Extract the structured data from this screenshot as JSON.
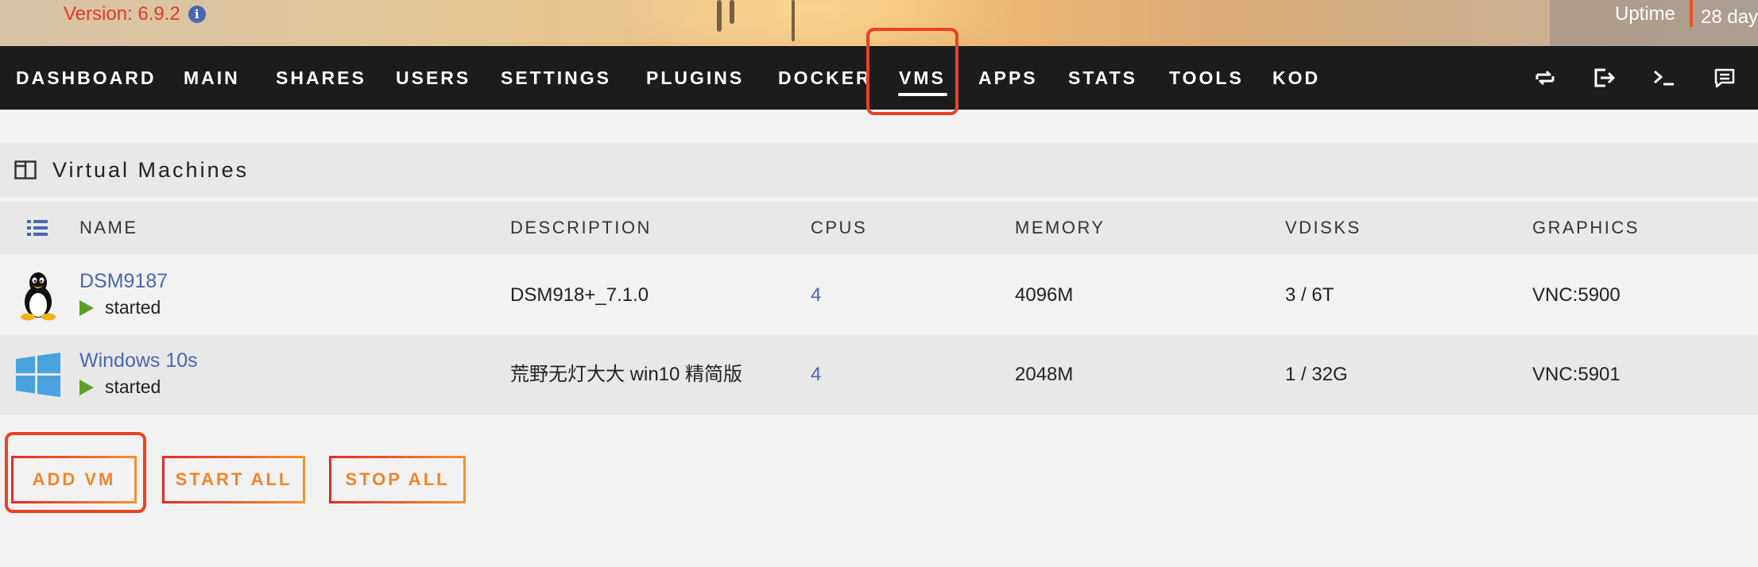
{
  "header": {
    "version": "Version: 6.9.2",
    "uptime_label": "Uptime",
    "uptime_value": "28 day"
  },
  "nav": {
    "items": [
      "DASHBOARD",
      "MAIN",
      "SHARES",
      "USERS",
      "SETTINGS",
      "PLUGINS",
      "DOCKER",
      "VMS",
      "APPS",
      "STATS",
      "TOOLS",
      "KOD"
    ],
    "active": "VMS",
    "icons": [
      "feedback-loop-icon",
      "logout-icon",
      "terminal-icon",
      "notes-icon"
    ]
  },
  "panel": {
    "title": "Virtual Machines",
    "columns": {
      "name": "NAME",
      "description": "DESCRIPTION",
      "cpus": "CPUS",
      "memory": "MEMORY",
      "vdisks": "VDISKS",
      "graphics": "GRAPHICS"
    },
    "rows": [
      {
        "os_icon": "linux-tux-icon",
        "name": "DSM9187",
        "state": "started",
        "description": "DSM918+_7.1.0",
        "cpus": "4",
        "memory": "4096M",
        "vdisks": "3 / 6T",
        "graphics": "VNC:5900"
      },
      {
        "os_icon": "windows-icon",
        "name": "Windows 10s",
        "state": "started",
        "description": "荒野无灯大大 win10 精简版",
        "cpus": "4",
        "memory": "2048M",
        "vdisks": "1 / 32G",
        "graphics": "VNC:5901"
      }
    ]
  },
  "buttons": {
    "add_vm": "ADD VM",
    "start_all": "START ALL",
    "stop_all": "STOP ALL"
  },
  "colors": {
    "accent_link": "#4a66ae",
    "button_text": "#f0852c",
    "highlight": "#e84225",
    "nav_bg": "#1c1c1c",
    "running": "#5aa028"
  }
}
